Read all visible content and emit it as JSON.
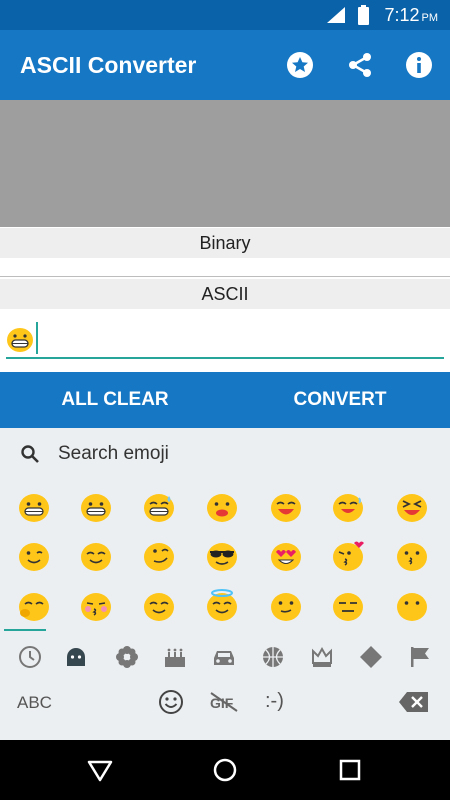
{
  "status_bar": {
    "time": "7:12",
    "ampm": "PM"
  },
  "app_bar": {
    "title": "ASCII Converter",
    "icons": [
      "star-icon",
      "share-icon",
      "info-icon"
    ]
  },
  "fields": {
    "binary_label": "Binary",
    "ascii_label": "ASCII"
  },
  "buttons": {
    "all_clear": "ALL CLEAR",
    "convert": "CONVERT"
  },
  "keyboard": {
    "search_placeholder": "Search emoji",
    "abc_label": "ABC",
    "kaomoji_label": ":-)",
    "categories": [
      "recent-clock-icon",
      "smileys-icon",
      "nature-flower-icon",
      "food-cake-icon",
      "car-icon",
      "activity-ball-icon",
      "objects-crown-icon",
      "symbols-diamond-icon",
      "flags-icon"
    ]
  },
  "colors": {
    "app_bar": "#1677c4",
    "status_bar": "#0a62a8",
    "accent": "#26a69a",
    "emoji_yellow": "#ffc61a"
  }
}
